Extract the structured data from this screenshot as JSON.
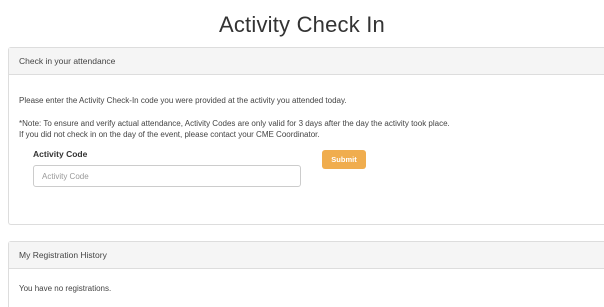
{
  "page": {
    "title": "Activity Check In"
  },
  "checkin": {
    "heading": "Check in your attendance",
    "instructions": "Please enter the Activity Check-In code you were provided at the activity you attended today.",
    "note_line1": "*Note: To ensure and verify actual attendance, Activity Codes are only valid for 3 days after the day the activity took place.",
    "note_line2": "If you did not check in on the day of the event, please contact your CME Coordinator.",
    "code_label": "Activity Code",
    "code_placeholder": "Activity Code",
    "code_value": "",
    "submit_label": "Submit",
    "submit_color": "#f0ad4e"
  },
  "history": {
    "heading": "My Registration History",
    "empty_text": "You have no registrations."
  }
}
